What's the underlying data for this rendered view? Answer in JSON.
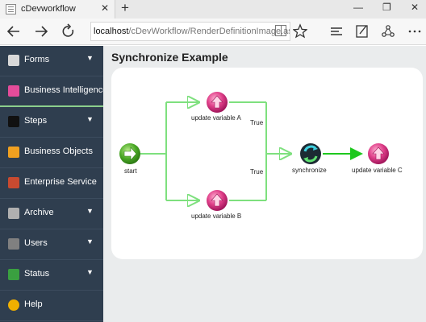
{
  "browser": {
    "tab_title": "cDevworkflow",
    "tab_close": "✕",
    "new_tab": "+",
    "window_controls": {
      "minimize": "—",
      "restore": "❐",
      "close": "✕"
    },
    "url_host": "localhost",
    "url_path": "/cDevWorkflow/RenderDefinitionImage.asp",
    "icons": [
      "back-arrow-icon",
      "forward-arrow-icon",
      "refresh-icon",
      "reading-view-icon",
      "favorite-star-icon",
      "hub-icon",
      "web-note-icon",
      "share-icon",
      "more-icon"
    ]
  },
  "sidebar": {
    "items": [
      {
        "label": "Forms",
        "icon": "forms-icon",
        "icon_color": "#d8d8d8",
        "caret": "▼"
      },
      {
        "label": "Business Intelligence",
        "icon": "business-intelligence-icon",
        "icon_color": "#e44c9a",
        "caret": ""
      },
      {
        "label": "Steps",
        "icon": "steps-icon",
        "icon_color": "#111111",
        "caret": "▼"
      },
      {
        "label": "Business Objects",
        "icon": "business-objects-icon",
        "icon_color": "#f0a020",
        "caret": ""
      },
      {
        "label": "Enterprise Service",
        "icon": "enterprise-service-icon",
        "icon_color": "#c84a30",
        "caret": ""
      },
      {
        "label": "Archive",
        "icon": "archive-icon",
        "icon_color": "#b0b0b0",
        "caret": "▼"
      },
      {
        "label": "Users",
        "icon": "users-icon",
        "icon_color": "#808080",
        "caret": "▼"
      },
      {
        "label": "Status",
        "icon": "status-icon",
        "icon_color": "#3aa040",
        "caret": "▼"
      },
      {
        "label": "Help",
        "icon": "help-icon",
        "icon_color": "#f0b000",
        "caret": ""
      }
    ]
  },
  "main": {
    "title": "Synchronize Example",
    "workflow": {
      "nodes": {
        "start": "start",
        "update_a": "update variable A",
        "update_b": "update variable B",
        "synchronize": "synchronize",
        "update_c": "update variable C"
      },
      "conditions": {
        "true_top": "True",
        "true_bottom": "True"
      },
      "colors": {
        "connector": "#7ee07e",
        "connector_dark": "#1ec81e",
        "start_node": "#4aa826",
        "update_node": "#e0408a"
      }
    }
  }
}
